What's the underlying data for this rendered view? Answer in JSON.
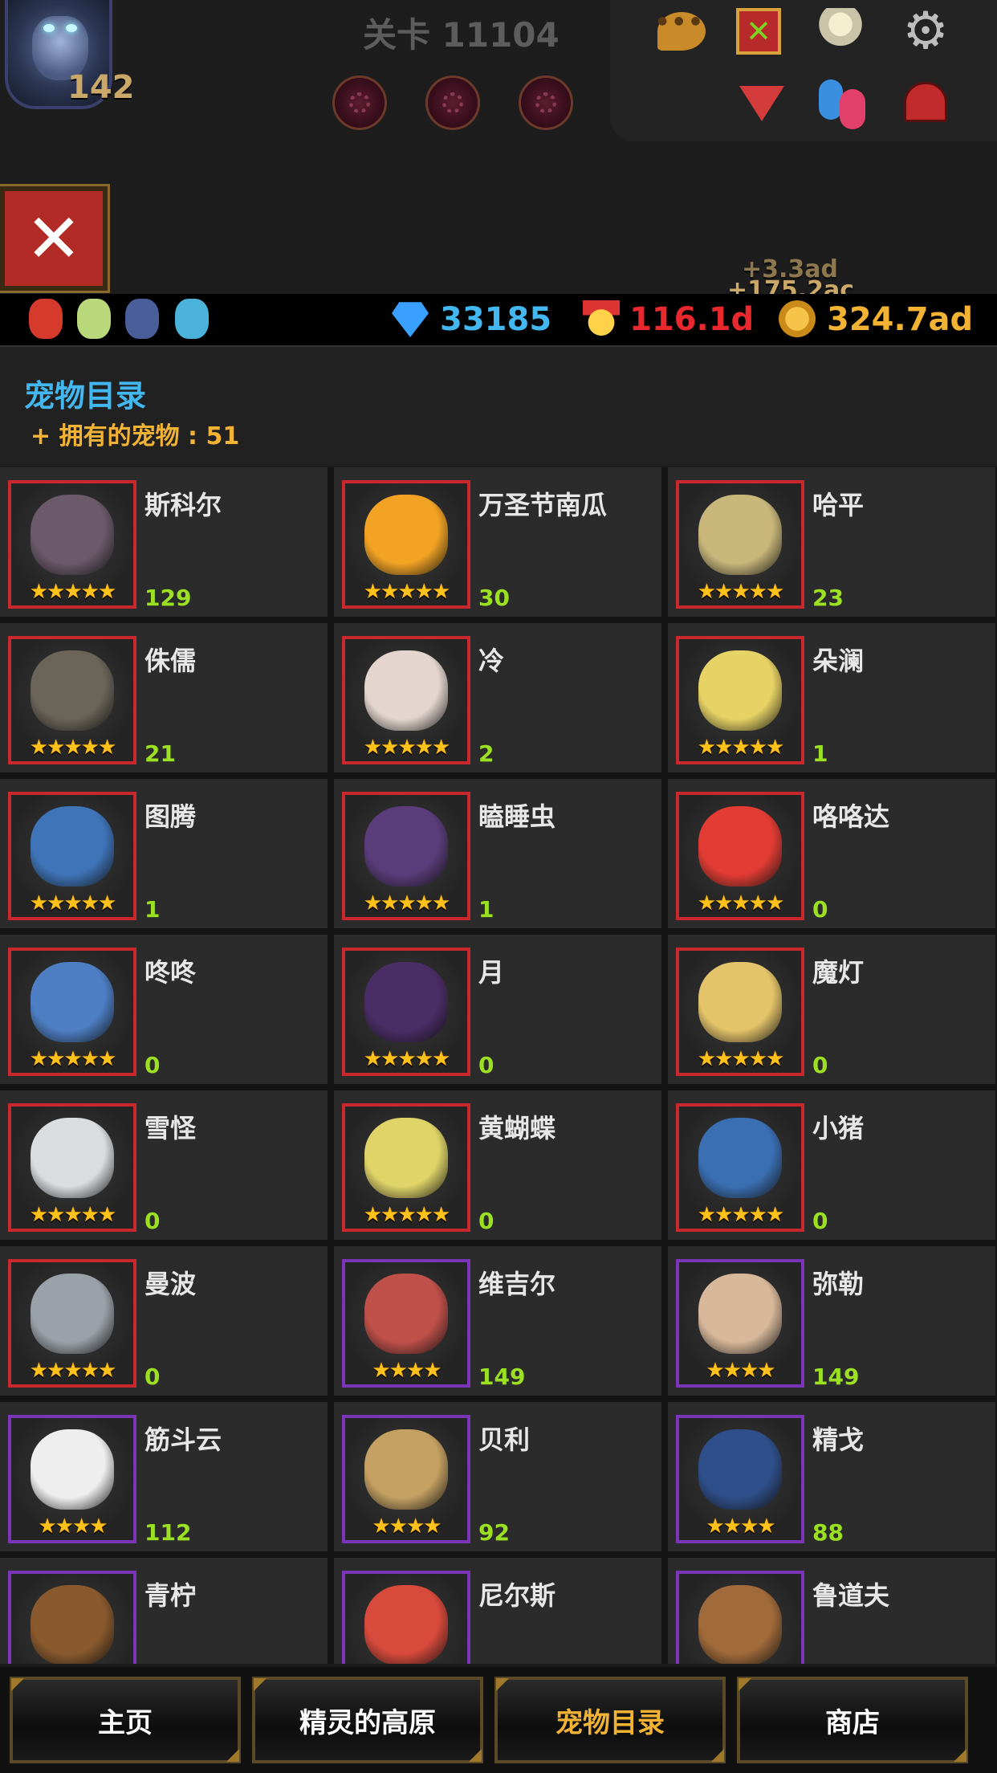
{
  "hud": {
    "stage_label": "关卡 11104",
    "boss_level": "142",
    "icons": [
      "chat-icon",
      "calendar-icon",
      "angel-icon",
      "gear-icon",
      "collapse-arrow-icon",
      "friends-icon",
      "mailbox-icon"
    ]
  },
  "resources": {
    "heroes": [
      "hero-red-icon",
      "hero-green-icon",
      "hero-knight-icon",
      "hero-blue-icon"
    ],
    "gems": "33185",
    "medals": "116.1d",
    "gold": "324.7ad",
    "gold_gain_1": "+3.3ad",
    "gold_gain_2": "+175.2ac"
  },
  "catalog": {
    "title": "宠物目录",
    "owned": "+ 拥有的宠物 : 51"
  },
  "pets": [
    {
      "name": "斯科尔",
      "count": "129",
      "stars": "★★★★★",
      "rarity": "red",
      "color": "#6b5a6a"
    },
    {
      "name": "万圣节南瓜",
      "count": "30",
      "stars": "★★★★★",
      "rarity": "red",
      "color": "#f2a324"
    },
    {
      "name": "哈平",
      "count": "23",
      "stars": "★★★★★",
      "rarity": "red",
      "color": "#c8b67a"
    },
    {
      "name": "侏儒",
      "count": "21",
      "stars": "★★★★★",
      "rarity": "red",
      "color": "#6b6459"
    },
    {
      "name": "冷",
      "count": "2",
      "stars": "★★★★★",
      "rarity": "red",
      "color": "#e4d6cf"
    },
    {
      "name": "朵澜",
      "count": "1",
      "stars": "★★★★★",
      "rarity": "red",
      "color": "#e7d365"
    },
    {
      "name": "图腾",
      "count": "1",
      "stars": "★★★★★",
      "rarity": "red",
      "color": "#3f74b8"
    },
    {
      "name": "瞌睡虫",
      "count": "1",
      "stars": "★★★★★",
      "rarity": "red",
      "color": "#5a3d7a"
    },
    {
      "name": "咯咯达",
      "count": "0",
      "stars": "★★★★★",
      "rarity": "red",
      "color": "#e23c34"
    },
    {
      "name": "咚咚",
      "count": "0",
      "stars": "★★★★★",
      "rarity": "red",
      "color": "#4e7fc4"
    },
    {
      "name": "月",
      "count": "0",
      "stars": "★★★★★",
      "rarity": "red",
      "color": "#4b2d66"
    },
    {
      "name": "魔灯",
      "count": "0",
      "stars": "★★★★★",
      "rarity": "red",
      "color": "#e4c46a"
    },
    {
      "name": "雪怪",
      "count": "0",
      "stars": "★★★★★",
      "rarity": "red",
      "color": "#d9dde0"
    },
    {
      "name": "黄蝴蝶",
      "count": "0",
      "stars": "★★★★★",
      "rarity": "red",
      "color": "#e0d468"
    },
    {
      "name": "小猪",
      "count": "0",
      "stars": "★★★★★",
      "rarity": "red",
      "color": "#3b6fb3"
    },
    {
      "name": "曼波",
      "count": "0",
      "stars": "★★★★★",
      "rarity": "red",
      "color": "#9aa1a8"
    },
    {
      "name": "维吉尔",
      "count": "149",
      "stars": "★★★★",
      "rarity": "purple",
      "color": "#c0504a"
    },
    {
      "name": "弥勒",
      "count": "149",
      "stars": "★★★★",
      "rarity": "purple",
      "color": "#d7b89a"
    },
    {
      "name": "筋斗云",
      "count": "112",
      "stars": "★★★★",
      "rarity": "purple",
      "color": "#eeeeee"
    },
    {
      "name": "贝利",
      "count": "92",
      "stars": "★★★★",
      "rarity": "purple",
      "color": "#c4a062"
    },
    {
      "name": "精戈",
      "count": "88",
      "stars": "★★★★",
      "rarity": "purple",
      "color": "#2f4f8a"
    },
    {
      "name": "青柠",
      "count": "",
      "stars": "",
      "rarity": "purple",
      "color": "#8a5a2e"
    },
    {
      "name": "尼尔斯",
      "count": "",
      "stars": "",
      "rarity": "purple",
      "color": "#d84a3c"
    },
    {
      "name": "鲁道夫",
      "count": "",
      "stars": "",
      "rarity": "purple",
      "color": "#a06a3a"
    }
  ],
  "nav": [
    {
      "label": "主页",
      "active": false
    },
    {
      "label": "精灵的高原",
      "active": false
    },
    {
      "label": "宠物目录",
      "active": true
    },
    {
      "label": "商店",
      "active": false
    }
  ],
  "colors": {
    "accent_blue": "#43b7ef",
    "accent_gold": "#f2b233",
    "count_green": "#9be021",
    "medal_red": "#e8282d",
    "rare_red_border": "#c9282d",
    "epic_purple_border": "#7a35b8"
  }
}
